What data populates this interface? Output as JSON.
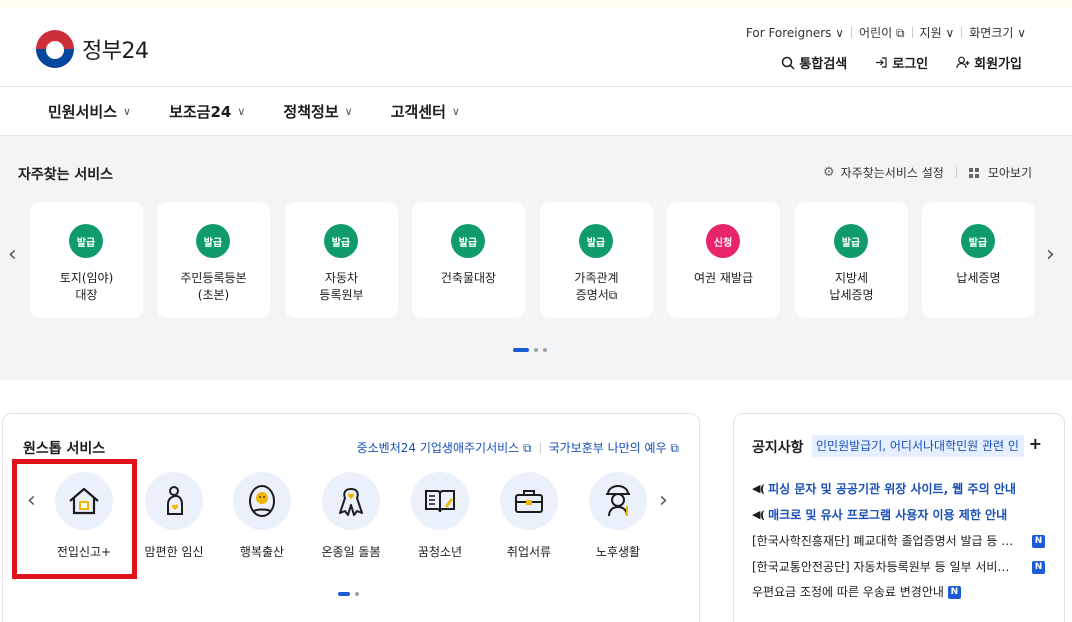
{
  "header": {
    "logo_text": "정부24",
    "utility": [
      "For Foreigners ∨",
      "어린이 ⧉",
      "지원 ∨",
      "화면크기 ∨"
    ],
    "search_label": "통합검색",
    "login_label": "로그인",
    "signup_label": "회원가입"
  },
  "gnb": {
    "items": [
      "민원서비스",
      "보조금24",
      "정책정보",
      "고객센터"
    ]
  },
  "favorites": {
    "title": "자주찾는 서비스",
    "settings_label": "자주찾는서비스 설정",
    "collect_label": "모아보기",
    "cards": [
      {
        "badge": "발급",
        "label": "토지(임야)\n대장"
      },
      {
        "badge": "발급",
        "label": "주민등록등본\n(초본)"
      },
      {
        "badge": "발급",
        "label": "자동차\n등록원부"
      },
      {
        "badge": "발급",
        "label": "건축물대장"
      },
      {
        "badge": "발급",
        "label": "가족관계\n증명서⧉"
      },
      {
        "badge": "신청",
        "label": "여권 재발급"
      },
      {
        "badge": "발급",
        "label": "지방세\n납세증명"
      },
      {
        "badge": "발급",
        "label": "납세증명"
      }
    ],
    "colors": {
      "issue": "#0f9b6c",
      "apply": "#e8256a"
    }
  },
  "one_stop": {
    "title": "원스톱 서비스",
    "link1": "중소벤처24 기업생애주기서비스 ⧉",
    "link2": "국가보훈부 나만의 예우 ⧉",
    "services": [
      {
        "label": "전입신고+",
        "icon": "house-icon"
      },
      {
        "label": "맘편한 임신",
        "icon": "pregnancy-icon"
      },
      {
        "label": "행복출산",
        "icon": "baby-icon"
      },
      {
        "label": "온종일 돌봄",
        "icon": "ribbon-icon"
      },
      {
        "label": "꿈청소년",
        "icon": "book-icon"
      },
      {
        "label": "취업서류",
        "icon": "briefcase-icon"
      },
      {
        "label": "노후생활",
        "icon": "elder-icon"
      }
    ]
  },
  "notice": {
    "title": "공지사항",
    "ticker": "인민원발급기, 어디서나대학민원 관련 인",
    "items": [
      {
        "text": "피싱 문자 및 공공기관 위장 사이트, 웹 주의 안내",
        "hot": true
      },
      {
        "text": "매크로 및 유사 프로그램 사용자 이용 제한 안내",
        "hot": true
      },
      {
        "text": "[한국사학진흥재단] 폐교대학 졸업증명서 발급 등 …",
        "hot": false,
        "badge": "N"
      },
      {
        "text": "[한국교통안전공단] 자동차등록원부 등 일부 서비…",
        "hot": false,
        "badge": "N"
      },
      {
        "text": "우편요금 조정에 따른 우송료 변경안내",
        "hot": false,
        "badge": "N"
      }
    ]
  }
}
